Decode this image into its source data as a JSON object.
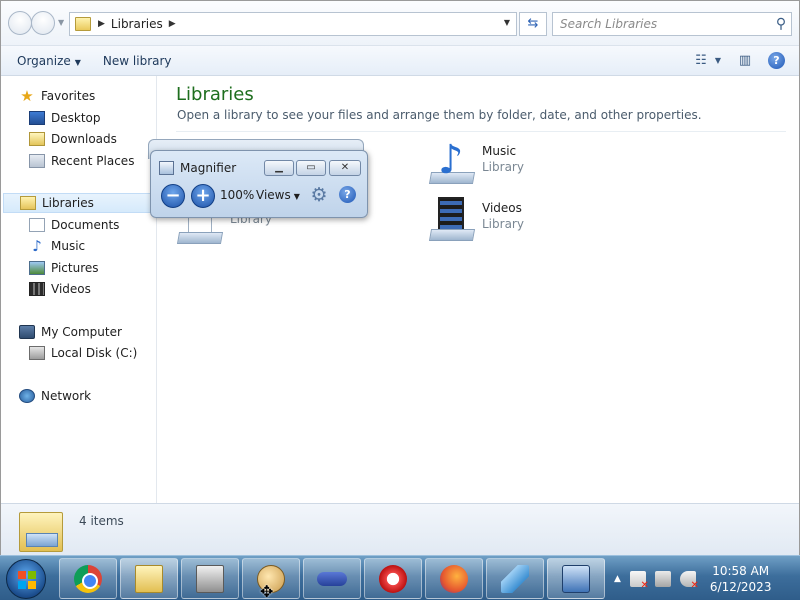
{
  "address": {
    "crumb": "Libraries",
    "search_placeholder": "Search Libraries"
  },
  "toolbar": {
    "organize": "Organize",
    "new_library": "New library"
  },
  "sidebar": {
    "favorites": "Favorites",
    "desktop": "Desktop",
    "downloads": "Downloads",
    "recent_places": "Recent Places",
    "libraries": "Libraries",
    "documents": "Documents",
    "music": "Music",
    "pictures": "Pictures",
    "videos": "Videos",
    "my_computer": "My Computer",
    "local_disk": "Local Disk (C:)",
    "network": "Network"
  },
  "content": {
    "title": "Libraries",
    "subtitle": "Open a library to see your files and arrange them by folder, date, and other properties.",
    "tiles": [
      {
        "name": "",
        "type": "Library"
      },
      {
        "name": "Music",
        "type": "Library"
      },
      {
        "name": "Videos",
        "type": "Library"
      }
    ]
  },
  "details": {
    "count": "4 items"
  },
  "magnifier": {
    "title": "Magnifier",
    "zoom": "100%",
    "views": "Views"
  },
  "clock": {
    "time": "10:58 AM",
    "date": "6/12/2023"
  },
  "colors": {
    "accent_title": "#1e6e1e",
    "taskbar": "#3d6e9c"
  }
}
